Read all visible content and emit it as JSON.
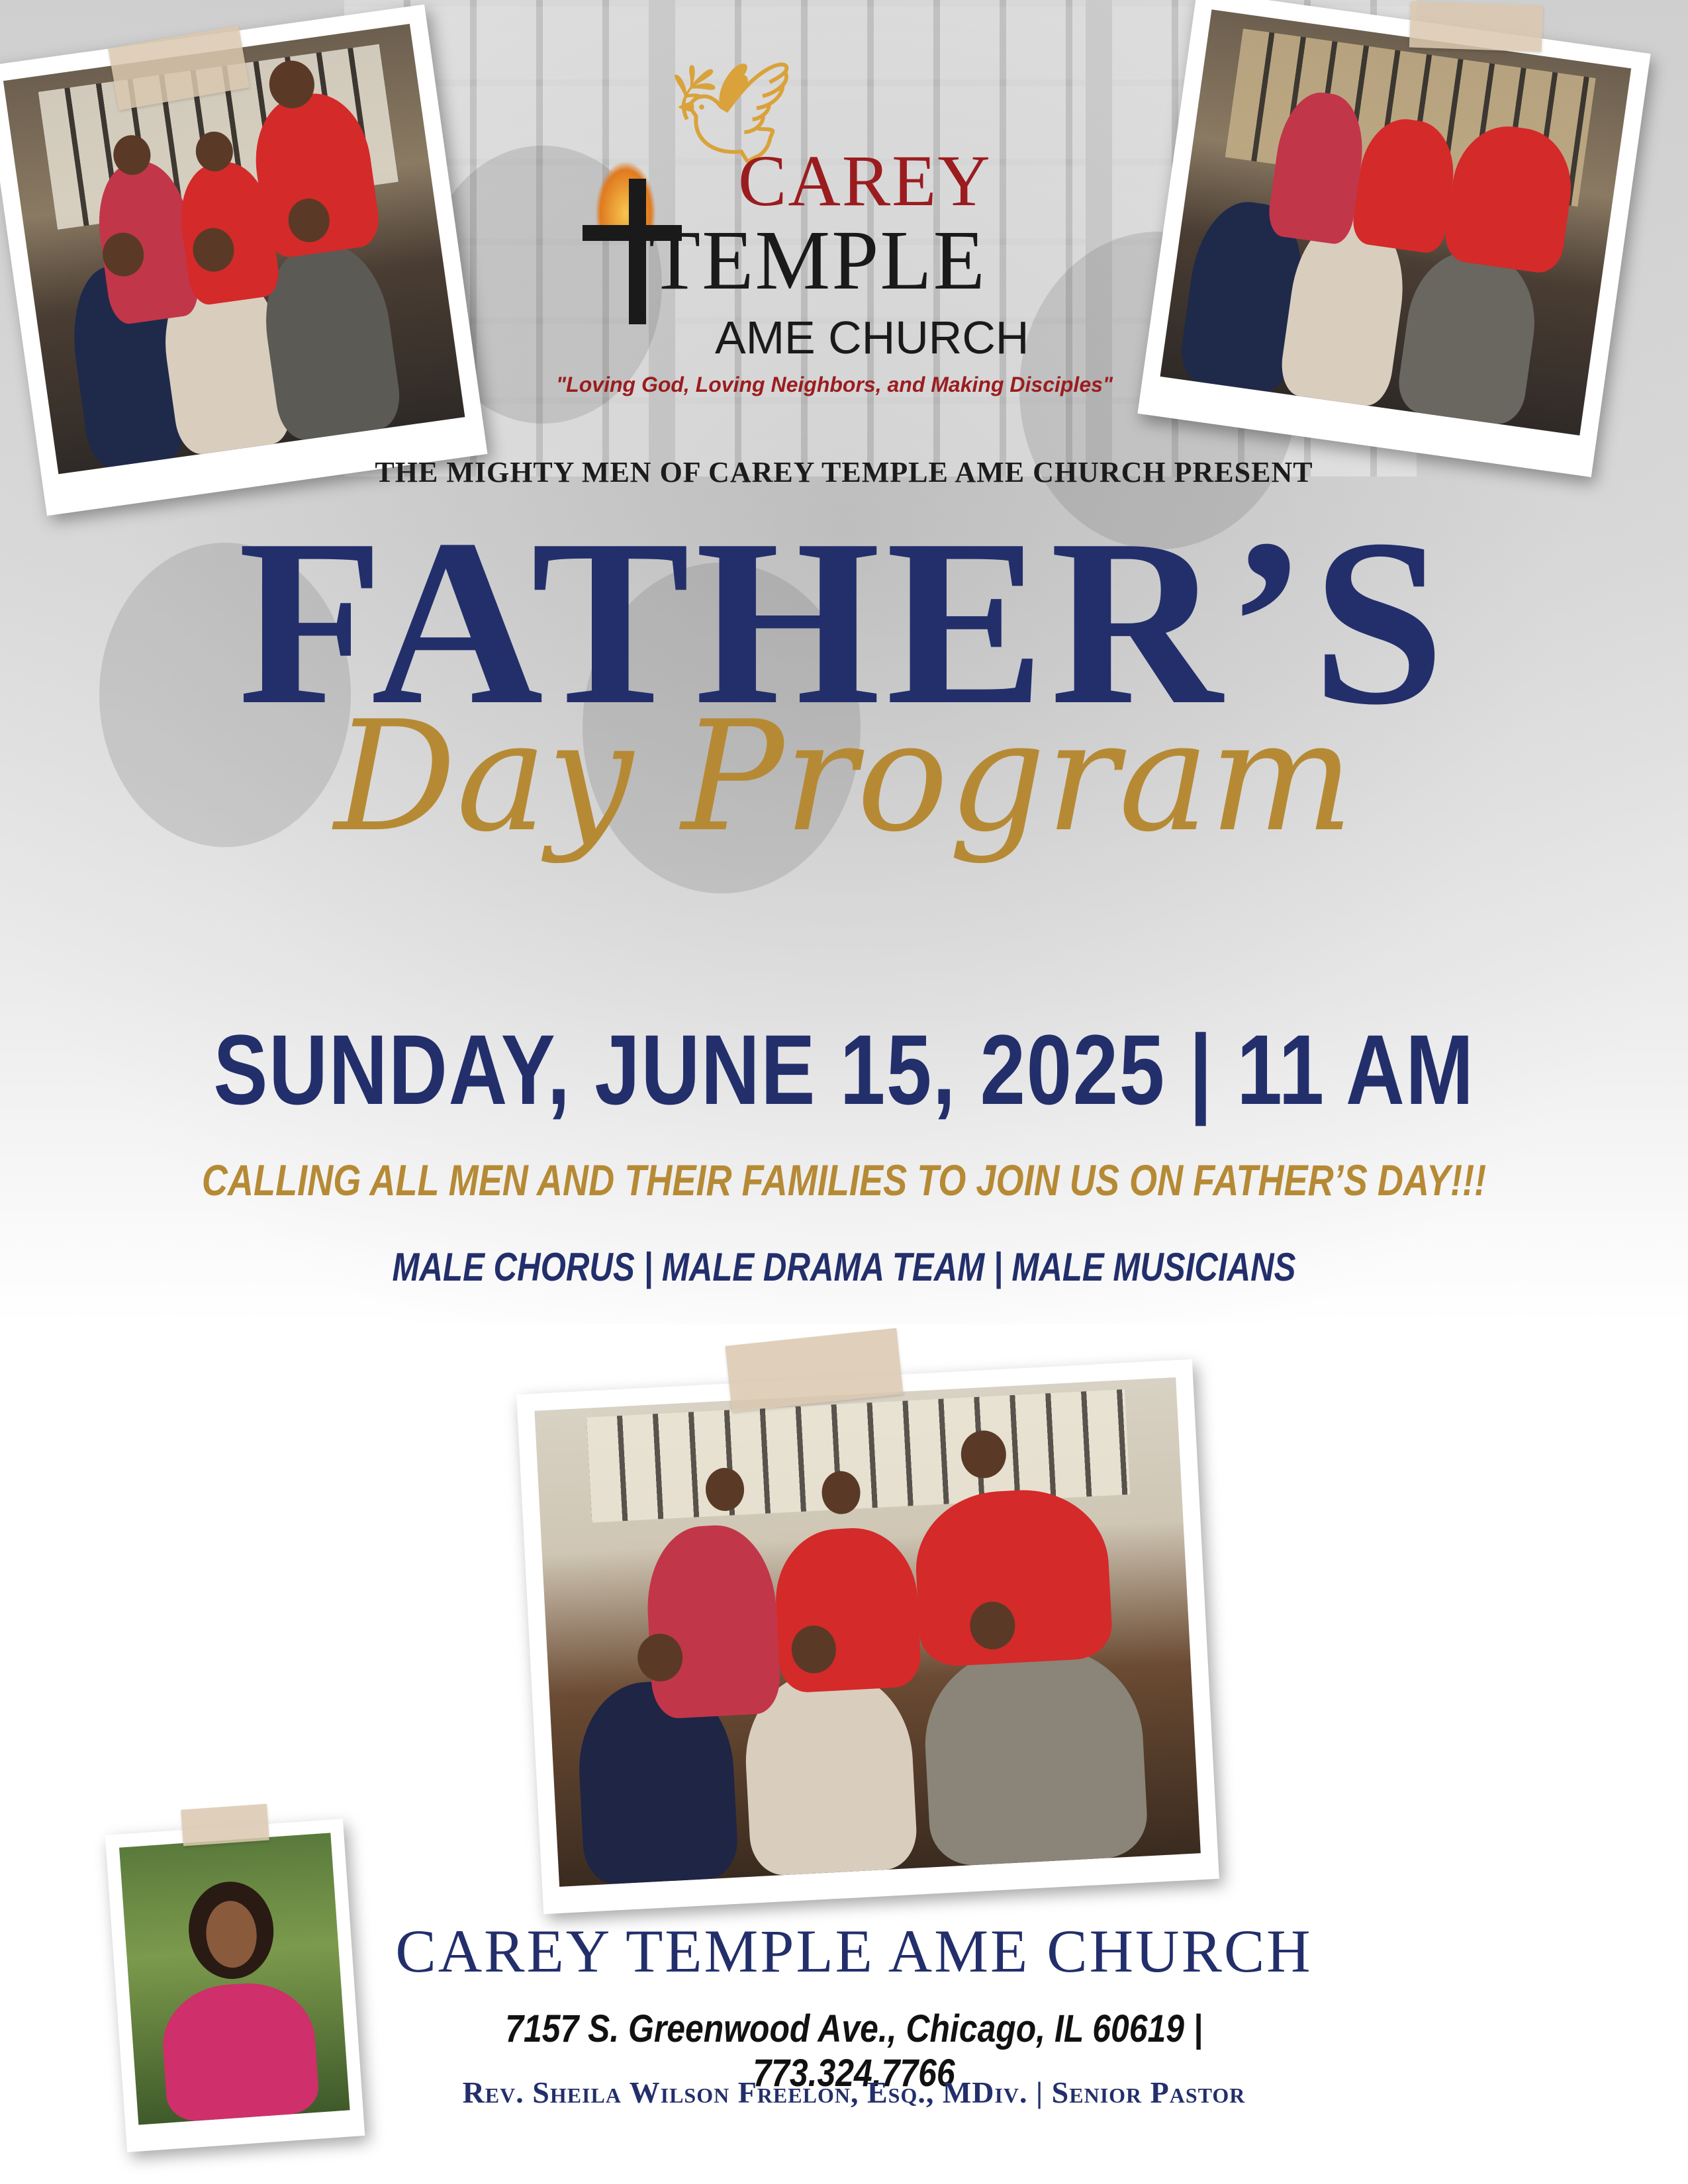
{
  "logo": {
    "line1": "CAREY",
    "line2": "TEMPLE",
    "line3": "AME CHURCH",
    "tagline": "\"Loving God, Loving Neighbors, and Making Disciples\""
  },
  "presenter": "THE MIGHTY MEN OF CAREY TEMPLE AME CHURCH PRESENT",
  "title": {
    "main": "FATHER’S",
    "script": "Day Program"
  },
  "event": {
    "date_time": "SUNDAY, JUNE 15, 2025 | 11 AM",
    "invitation": "CALLING ALL MEN AND THEIR FAMILIES TO JOIN US ON FATHER’S DAY!!!",
    "groups": "MALE CHORUS | MALE DRAMA TEAM | MALE MUSICIANS"
  },
  "footer": {
    "church_name": "CAREY TEMPLE AME CHURCH",
    "address": "7157 S. Greenwood Ave., Chicago, IL 60619 | 773.324.7766",
    "pastor": "Rev. Sheila Wilson Freelon, Esq., MDiv. | Senior Pastor"
  },
  "colors": {
    "navy": "#232f6b",
    "gold": "#b68a35",
    "red": "#9b1c1f"
  },
  "icons": [
    "dove-icon",
    "flame-icon",
    "cross-icon"
  ]
}
